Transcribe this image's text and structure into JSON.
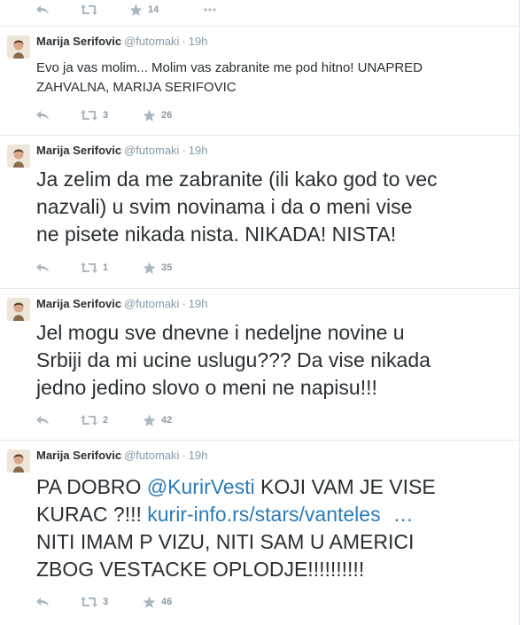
{
  "colors": {
    "link": "#2b7bb9",
    "muted": "#8899a6",
    "text": "#292f33",
    "border": "#e1e8ed"
  },
  "icons": {
    "reply": "reply-icon",
    "retweet": "retweet-icon",
    "favorite": "star-icon",
    "more": "more-icon"
  },
  "top_actions": {
    "retweets": "",
    "favorites": "14"
  },
  "tweets": [
    {
      "fullname": "Marija Serifovic",
      "username": "@futomaki",
      "dot": "·",
      "time": "19h",
      "line1": "Evo ja vas molim... Molim vas zabranite me pod hitno! UNAPRED",
      "line2": "ZAHVALNA, MARIJA SERIFOVIC",
      "retweets": "3",
      "favorites": "26"
    },
    {
      "fullname": "Marija Serifovic",
      "username": "@futomaki",
      "dot": "·",
      "time": "19h",
      "line1": "Ja zelim da me zabranite (ili kako god to vec",
      "line2": "nazvali) u svim novinama i da o meni vise",
      "line3": "ne pisete nikada nista. NIKADA! NISTA!",
      "retweets": "1",
      "favorites": "35"
    },
    {
      "fullname": "Marija Serifovic",
      "username": "@futomaki",
      "dot": "·",
      "time": "19h",
      "line1": "Jel mogu sve dnevne i nedeljne novine u",
      "line2": "Srbiji da mi ucine uslugu??? Da vise nikada",
      "line3": "jedno jedino slovo o meni ne napisu!!!",
      "retweets": "2",
      "favorites": "42"
    },
    {
      "fullname": "Marija Serifovic",
      "username": "@futomaki",
      "dot": "·",
      "time": "19h",
      "line1_prefix": "PA DOBRO ",
      "mention": "@KurirVesti",
      "line1_suffix": " KOJI VAM JE VISE",
      "line2_prefix": "KURAC ?!!! ",
      "url": "kurir-info.rs/stars/vanteles",
      "ellipsis": "…",
      "line3": "NITI IMAM P VIZU, NITI SAM U AMERICI",
      "line4": "ZBOG VESTACKE OPLODJE!!!!!!!!!!",
      "retweets": "3",
      "favorites": "46"
    }
  ]
}
